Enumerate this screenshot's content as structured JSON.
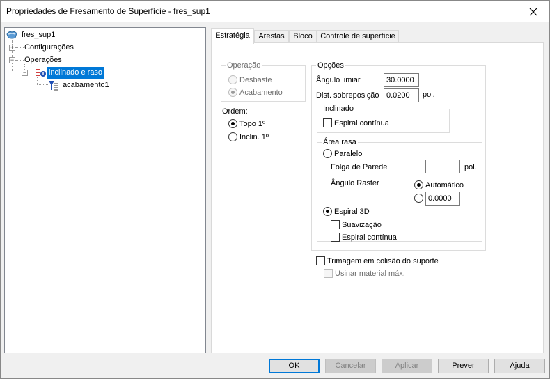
{
  "window": {
    "title": "Propriedades de Fresamento de Superfície - fres_sup1"
  },
  "tree": {
    "root": "fres_sup1",
    "configuracoes": "Configurações",
    "operacoes": "Operações",
    "inclinado": "inclinado e raso",
    "acabamento": "acabamento1",
    "expander_plus": "+",
    "expander_minus": "−"
  },
  "tabs": [
    "Estratégia",
    "Arestas",
    "Bloco",
    "Controle de superfície"
  ],
  "operacao": {
    "legend": "Operação",
    "desbaste": "Desbaste",
    "acabamento": "Acabamento"
  },
  "ordem": {
    "label": "Ordem:",
    "topo": "Topo 1º",
    "inclin": "Inclin. 1º"
  },
  "opcoes": {
    "legend": "Opções",
    "angulo_limiar_label": "Ângulo limiar",
    "angulo_limiar_value": "30.0000",
    "dist_label": "Dist. sobreposição",
    "dist_value": "0.0200",
    "dist_unit": "pol."
  },
  "inclinado": {
    "legend": "Inclinado",
    "espiral": "Espiral contínua"
  },
  "area_rasa": {
    "legend": "Área rasa",
    "paralelo": "Paralelo",
    "folga_label": "Folga de Parede",
    "folga_value": "",
    "folga_unit": "pol.",
    "angulo_raster_label": "Ângulo Raster",
    "automatico": "Automático",
    "angulo_value": "0.0000",
    "espiral3d": "Espiral 3D",
    "suavizacao": "Suavização",
    "espiral_continua": "Espiral contínua"
  },
  "trimagem": "Trimagem em colisão do suporte",
  "usinar": "Usinar material máx.",
  "buttons": {
    "ok": "OK",
    "cancelar": "Cancelar",
    "aplicar": "Aplicar",
    "prever": "Prever",
    "ajuda": "Ajuda"
  }
}
